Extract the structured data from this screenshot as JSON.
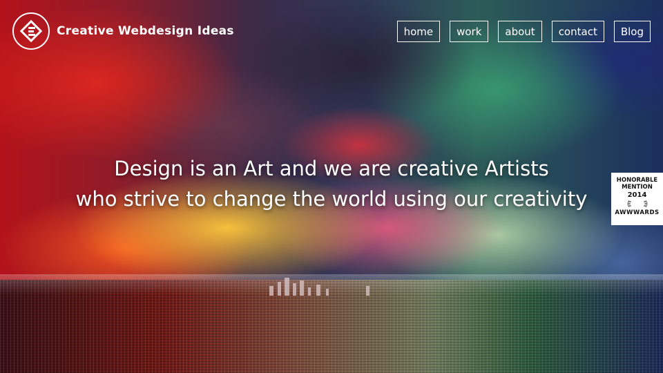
{
  "brand": {
    "name": "Creative Webdesign Ideas",
    "logo_icon": "circle-e-logo-icon"
  },
  "nav": {
    "items": [
      "home",
      "work",
      "about",
      "contact",
      "Blog"
    ]
  },
  "hero": {
    "line1": "Design is an Art and we are creative Artists",
    "line2": "who strive to change the world using our creativity"
  },
  "award": {
    "line1": "HONORABLE",
    "line2": "MENTION",
    "year": "2014",
    "brand": "AWWWARDS",
    "icon": "laurel-icon"
  },
  "colors": {
    "text": "#ffffff",
    "badge_bg": "#ffffff",
    "badge_text": "#111111"
  }
}
